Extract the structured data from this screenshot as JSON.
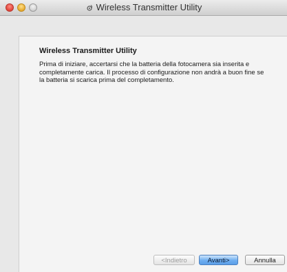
{
  "window": {
    "title": "Wireless Transmitter Utility",
    "title_icon": "app-icon"
  },
  "content": {
    "heading": "Wireless Transmitter Utility",
    "body": "Prima di iniziare, accertarsi che la batteria della fotocamera sia inserita e completamente carica. Il processo di configurazione non andrà a buon fine se la batteria si scarica prima del completamento."
  },
  "buttons": {
    "back_label": "<Indietro",
    "next_label": "Avanti>",
    "cancel_label": "Annulla"
  },
  "colors": {
    "default_button": "#5b9ee8",
    "close_button": "#e0443a",
    "minimize_button": "#e6a92c"
  }
}
